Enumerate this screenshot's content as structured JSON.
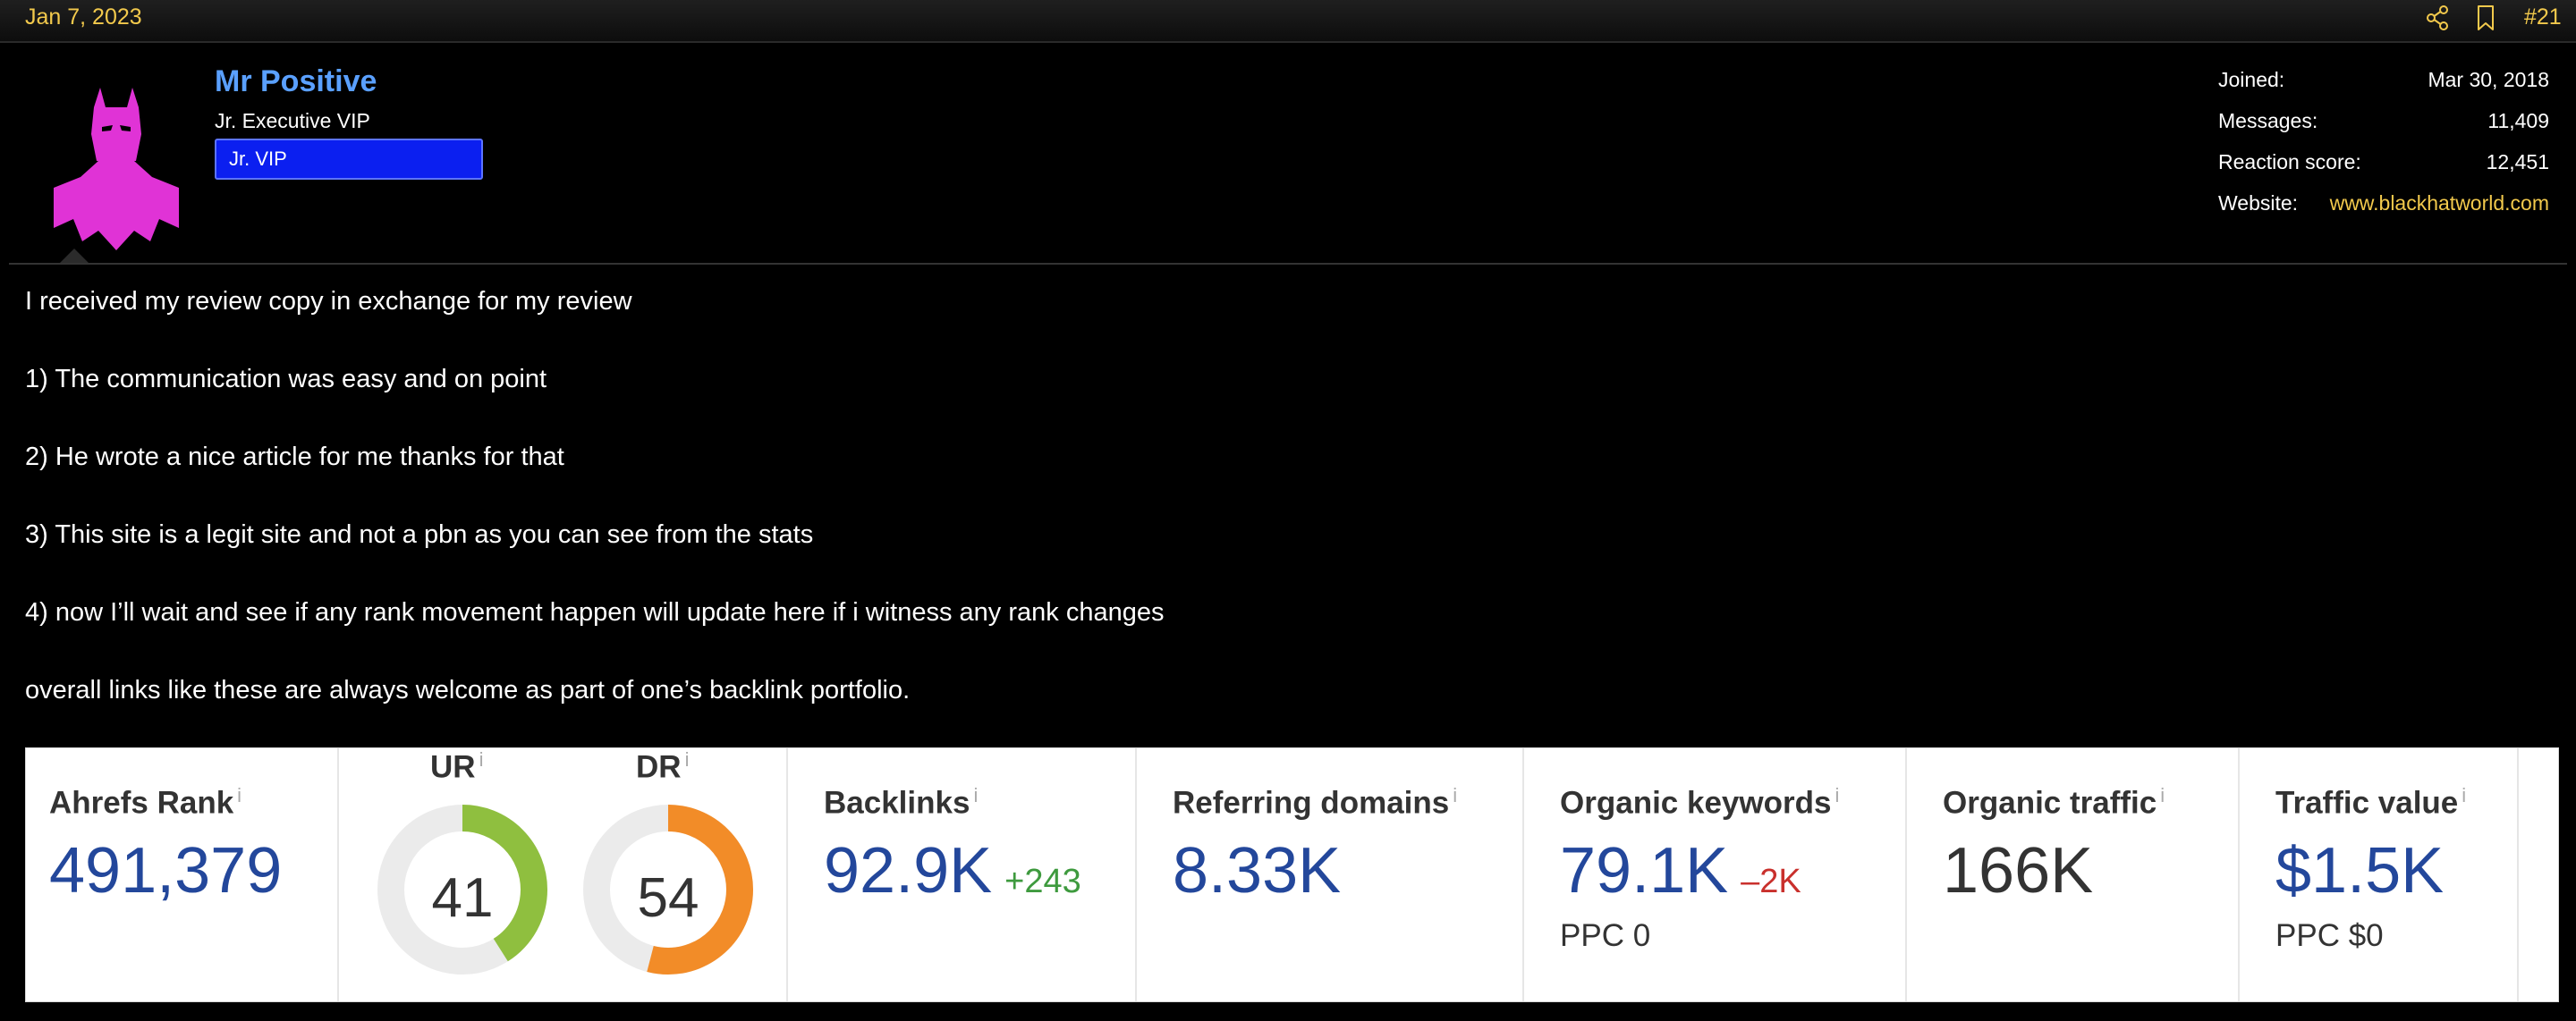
{
  "post": {
    "date": "Jan 7, 2023",
    "number": "#21",
    "share_icon": "share-icon",
    "bookmark_icon": "bookmark-icon"
  },
  "user": {
    "name": "Mr Positive",
    "title": "Jr. Executive VIP",
    "banner": "Jr. VIP",
    "avatar_color": "#e033d6",
    "stats": [
      {
        "label": "Joined:",
        "value": "Mar 30, 2018"
      },
      {
        "label": "Messages:",
        "value": "11,409"
      },
      {
        "label": "Reaction score:",
        "value": "12,451"
      },
      {
        "label": "Website:",
        "value": "www.blackhatworld.com"
      }
    ]
  },
  "message": {
    "lines": [
      "I received my review copy in exchange for my review",
      "1) The communication was easy and on point",
      "2) He wrote a nice article for me thanks for that",
      "3) This site is a legit site and not a pbn as you can see from the stats",
      "4) now I’ll wait and see if any rank movement happen will update here if i witness any rank changes",
      "overall links like these are always welcome as part of one’s backlink portfolio."
    ]
  },
  "ahrefs": {
    "info_mark": "i",
    "rank": {
      "label": "Ahrefs Rank",
      "value": "491,379"
    },
    "ur": {
      "label": "UR",
      "value": "41",
      "score": 41,
      "color": "#8fbf3f"
    },
    "dr": {
      "label": "DR",
      "value": "54",
      "score": 54,
      "color": "#f28c28"
    },
    "backlinks": {
      "label": "Backlinks",
      "value": "92.9K",
      "delta": "+243"
    },
    "refdomains": {
      "label": "Referring domains",
      "value": "8.33K"
    },
    "keywords": {
      "label": "Organic keywords",
      "value": "79.1K",
      "delta": "–2K",
      "sub": "PPC 0"
    },
    "traffic": {
      "label": "Organic traffic",
      "value": "166K"
    },
    "traffic_value": {
      "label": "Traffic value",
      "value": "$1.5K",
      "sub": "PPC $0"
    }
  }
}
